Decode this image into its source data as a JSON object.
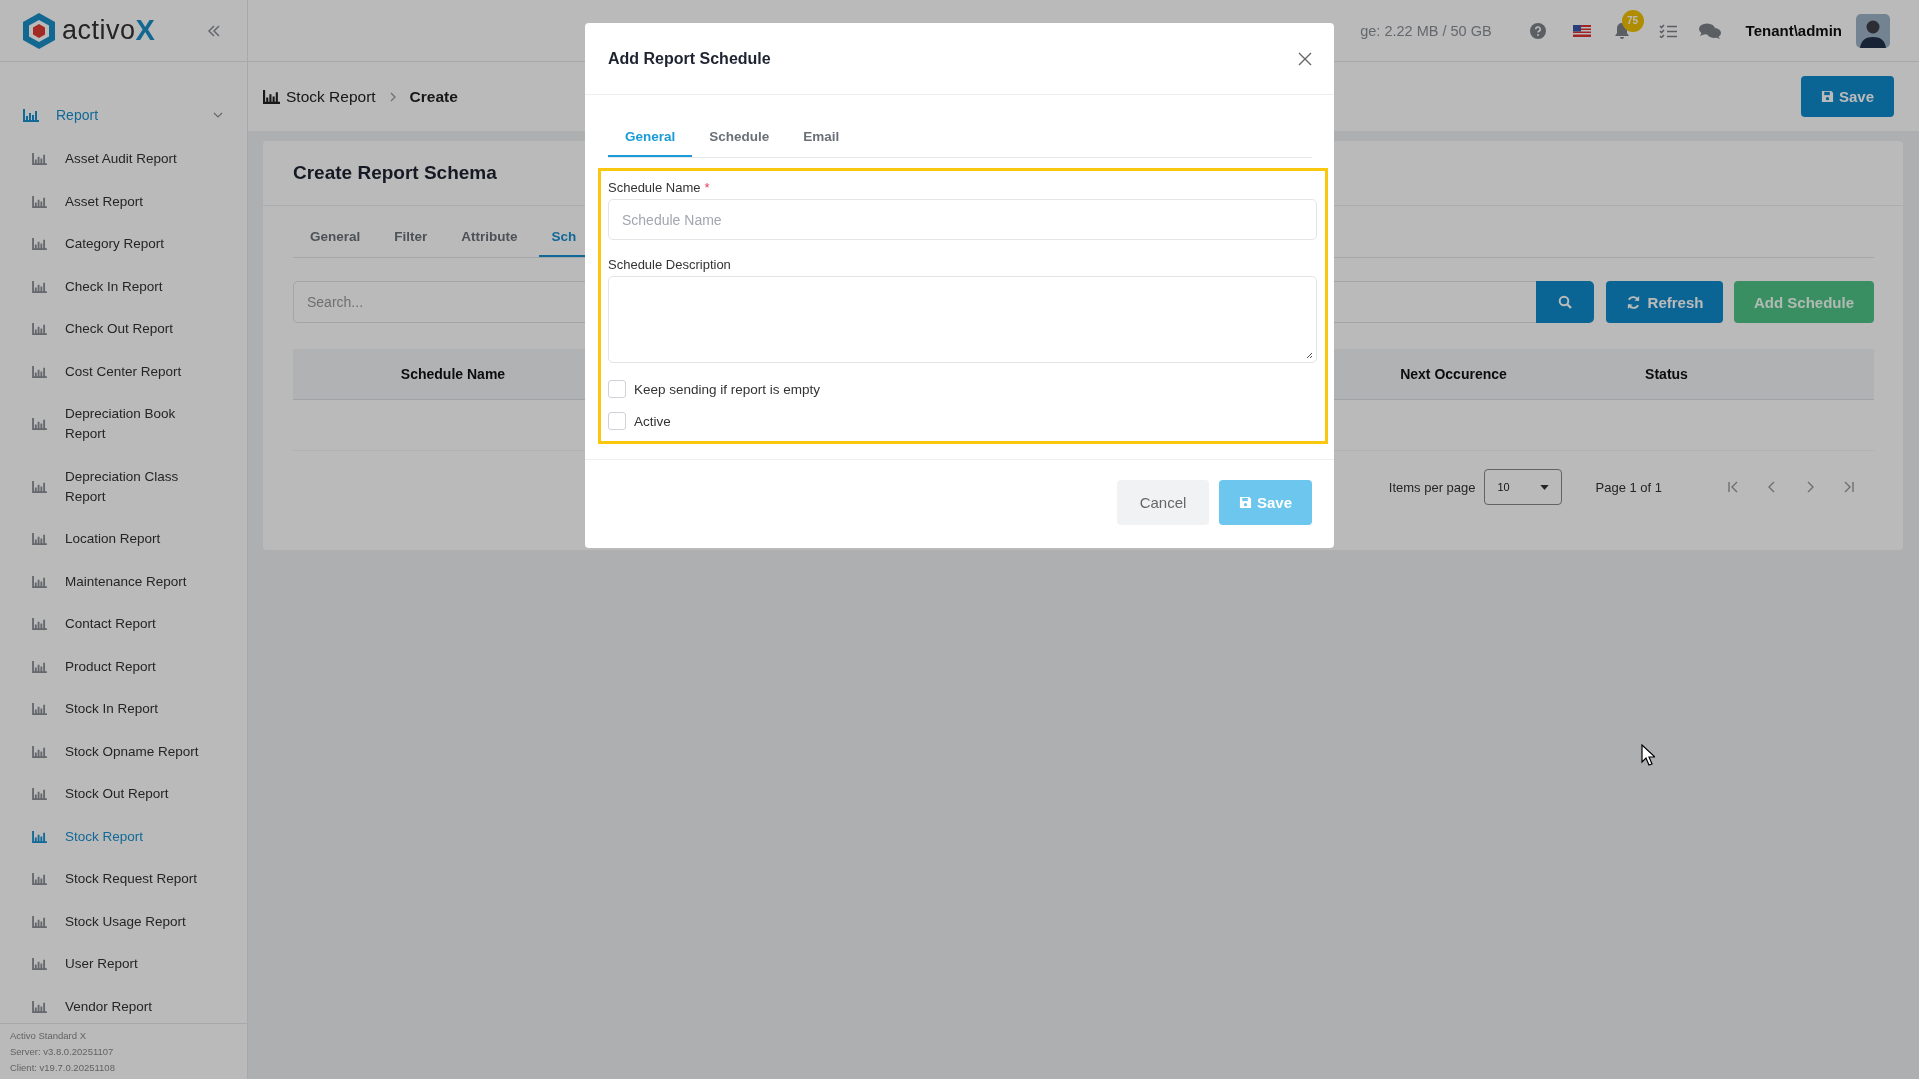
{
  "logo": {
    "name": "activo",
    "accent": "X"
  },
  "topbar": {
    "storage": "ge: 2.22 MB / 50 GB",
    "notification_count": "75",
    "user": "Tenant\\admin"
  },
  "sidebar": {
    "section": {
      "label": "Report",
      "expanded": true
    },
    "items": [
      {
        "label": "Asset Audit Report",
        "selected": false
      },
      {
        "label": "Asset Report",
        "selected": false
      },
      {
        "label": "Category Report",
        "selected": false
      },
      {
        "label": "Check In Report",
        "selected": false
      },
      {
        "label": "Check Out Report",
        "selected": false
      },
      {
        "label": "Cost Center Report",
        "selected": false
      },
      {
        "label": "Depreciation Book Report",
        "selected": false
      },
      {
        "label": "Depreciation Class Report",
        "selected": false
      },
      {
        "label": "Location Report",
        "selected": false
      },
      {
        "label": "Maintenance Report",
        "selected": false
      },
      {
        "label": "Contact Report",
        "selected": false
      },
      {
        "label": "Product Report",
        "selected": false
      },
      {
        "label": "Stock In Report",
        "selected": false
      },
      {
        "label": "Stock Opname Report",
        "selected": false
      },
      {
        "label": "Stock Out Report",
        "selected": false
      },
      {
        "label": "Stock Report",
        "selected": true
      },
      {
        "label": "Stock Request Report",
        "selected": false
      },
      {
        "label": "Stock Usage Report",
        "selected": false
      },
      {
        "label": "User Report",
        "selected": false
      },
      {
        "label": "Vendor Report",
        "selected": false
      }
    ],
    "footer": [
      "Activo Standard X",
      "Server: v3.8.0.20251107",
      "Client: v19.7.0.20251108"
    ]
  },
  "breadcrumb": [
    "Stock Report",
    "Create"
  ],
  "header_button": "Save",
  "card": {
    "title": "Create Report Schema",
    "tabs": [
      {
        "label": "General",
        "selected": false
      },
      {
        "label": "Filter",
        "selected": false
      },
      {
        "label": "Attribute",
        "selected": false
      },
      {
        "label": "Sch",
        "selected": true
      }
    ],
    "search": {
      "placeholder": "Search..."
    },
    "refresh_button": "Refresh",
    "add_button": "Add Schedule",
    "columns": [
      "Schedule Name",
      "Next Occurence",
      "Status"
    ],
    "pagination": {
      "items_per_page_label": "Items per page",
      "page_size": "10",
      "page_info": "Page 1 of 1"
    }
  },
  "modal": {
    "title": "Add Report Schedule",
    "tabs": [
      {
        "label": "General",
        "selected": true
      },
      {
        "label": "Schedule",
        "selected": false
      },
      {
        "label": "Email",
        "selected": false
      }
    ],
    "fields": [
      {
        "kind": "text",
        "label": "Schedule Name",
        "required_mark": "*",
        "placeholder": "Schedule Name"
      },
      {
        "kind": "textarea",
        "label": "Schedule Description"
      }
    ],
    "checkboxes": [
      {
        "label": "Keep sending if report is empty",
        "checked": false
      },
      {
        "label": "Active",
        "checked": false
      }
    ],
    "cancel_button": "Cancel",
    "save_button": "Save",
    "save_disabled": true
  }
}
